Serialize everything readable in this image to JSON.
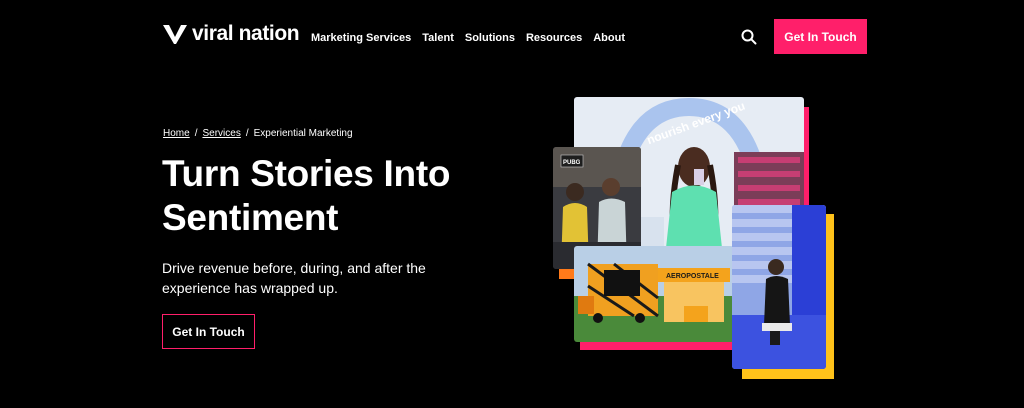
{
  "header": {
    "logo_text": "viral nation",
    "nav": [
      "Marketing Services",
      "Talent",
      "Solutions",
      "Resources",
      "About"
    ],
    "search_icon": "search-icon",
    "cta_label": "Get In Touch"
  },
  "hero": {
    "breadcrumb": {
      "home": "Home",
      "sep": "/",
      "services": "Services",
      "current": "Experiential Marketing"
    },
    "title": "Turn Stories Into Sentiment",
    "subtitle": "Drive revenue before, during, and after the experience has wrapped up.",
    "cta_label": "Get In Touch"
  },
  "collage": {
    "top_sign_text": "nourish every you",
    "pubg_badge": "PUBG",
    "truck_sign": "AEROPOSTALE",
    "accent_colors": {
      "pink": "#ff1f6a",
      "orange": "#ff7a1a",
      "yellow": "#ffc21a"
    }
  },
  "colors": {
    "brand_pink": "#ff1f6a",
    "background": "#000000"
  }
}
